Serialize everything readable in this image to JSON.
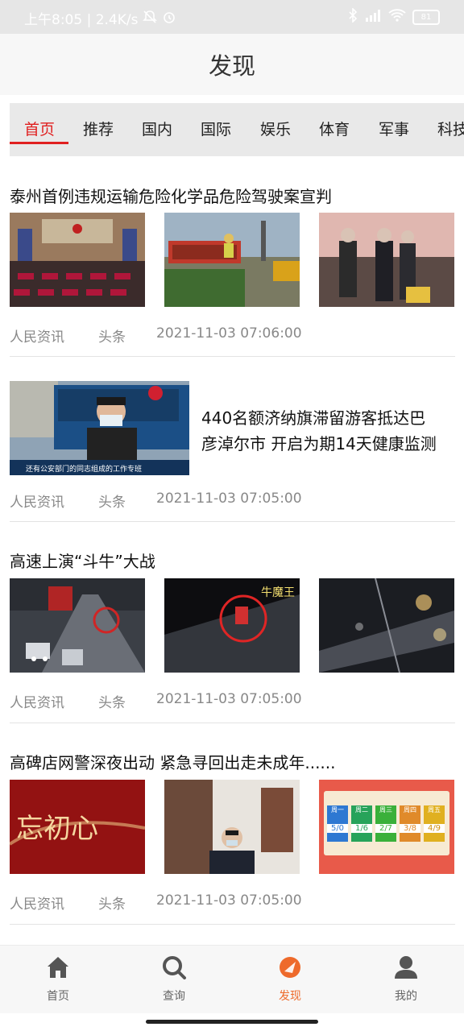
{
  "status_bar": {
    "time_speed": "上午8:05 | 2.4K/s",
    "battery": "81"
  },
  "header": {
    "title": "发现"
  },
  "tabs": [
    {
      "label": "首页",
      "active": true
    },
    {
      "label": "推荐"
    },
    {
      "label": "国内"
    },
    {
      "label": "国际"
    },
    {
      "label": "娱乐"
    },
    {
      "label": "体育"
    },
    {
      "label": "军事"
    },
    {
      "label": "科技"
    }
  ],
  "articles": [
    {
      "title": "泰州首例违规运输危险化学品危险驾驶案宣判",
      "source": "人民资讯",
      "tag": "头条",
      "time": "2021-11-03 07:06:00"
    },
    {
      "title_line1": "440名额济纳旗滞留游客抵达巴",
      "title_line2": "彦淖尔市 开启为期14天健康监测",
      "thumb_caption": "还有公安部门的同志组成的工作专班",
      "source": "人民资讯",
      "tag": "头条",
      "time": "2021-11-03 07:05:00"
    },
    {
      "title": "高速上演“斗牛”大战",
      "thumb_caption": "牛魔王",
      "source": "人民资讯",
      "tag": "头条",
      "time": "2021-11-03 07:05:00"
    },
    {
      "title": "高碑店网警深夜出动 紧急寻回出走未成年......",
      "thumb_caption": "忘初心",
      "days": [
        "周一",
        "周二",
        "周三",
        "周四",
        "周五"
      ],
      "day_numbers": [
        "5/0",
        "1/6",
        "2/7",
        "3/8",
        "4/9"
      ],
      "source": "人民资讯",
      "tag": "头条",
      "time": "2021-11-03 07:05:00"
    }
  ],
  "bottom_nav": [
    {
      "label": "首页",
      "icon": "home-icon"
    },
    {
      "label": "查询",
      "icon": "search-icon"
    },
    {
      "label": "发现",
      "icon": "discover-icon",
      "active": true
    },
    {
      "label": "我的",
      "icon": "user-icon"
    }
  ],
  "colors": {
    "accent": "#e02020",
    "nav_active": "#ee6a2b"
  }
}
